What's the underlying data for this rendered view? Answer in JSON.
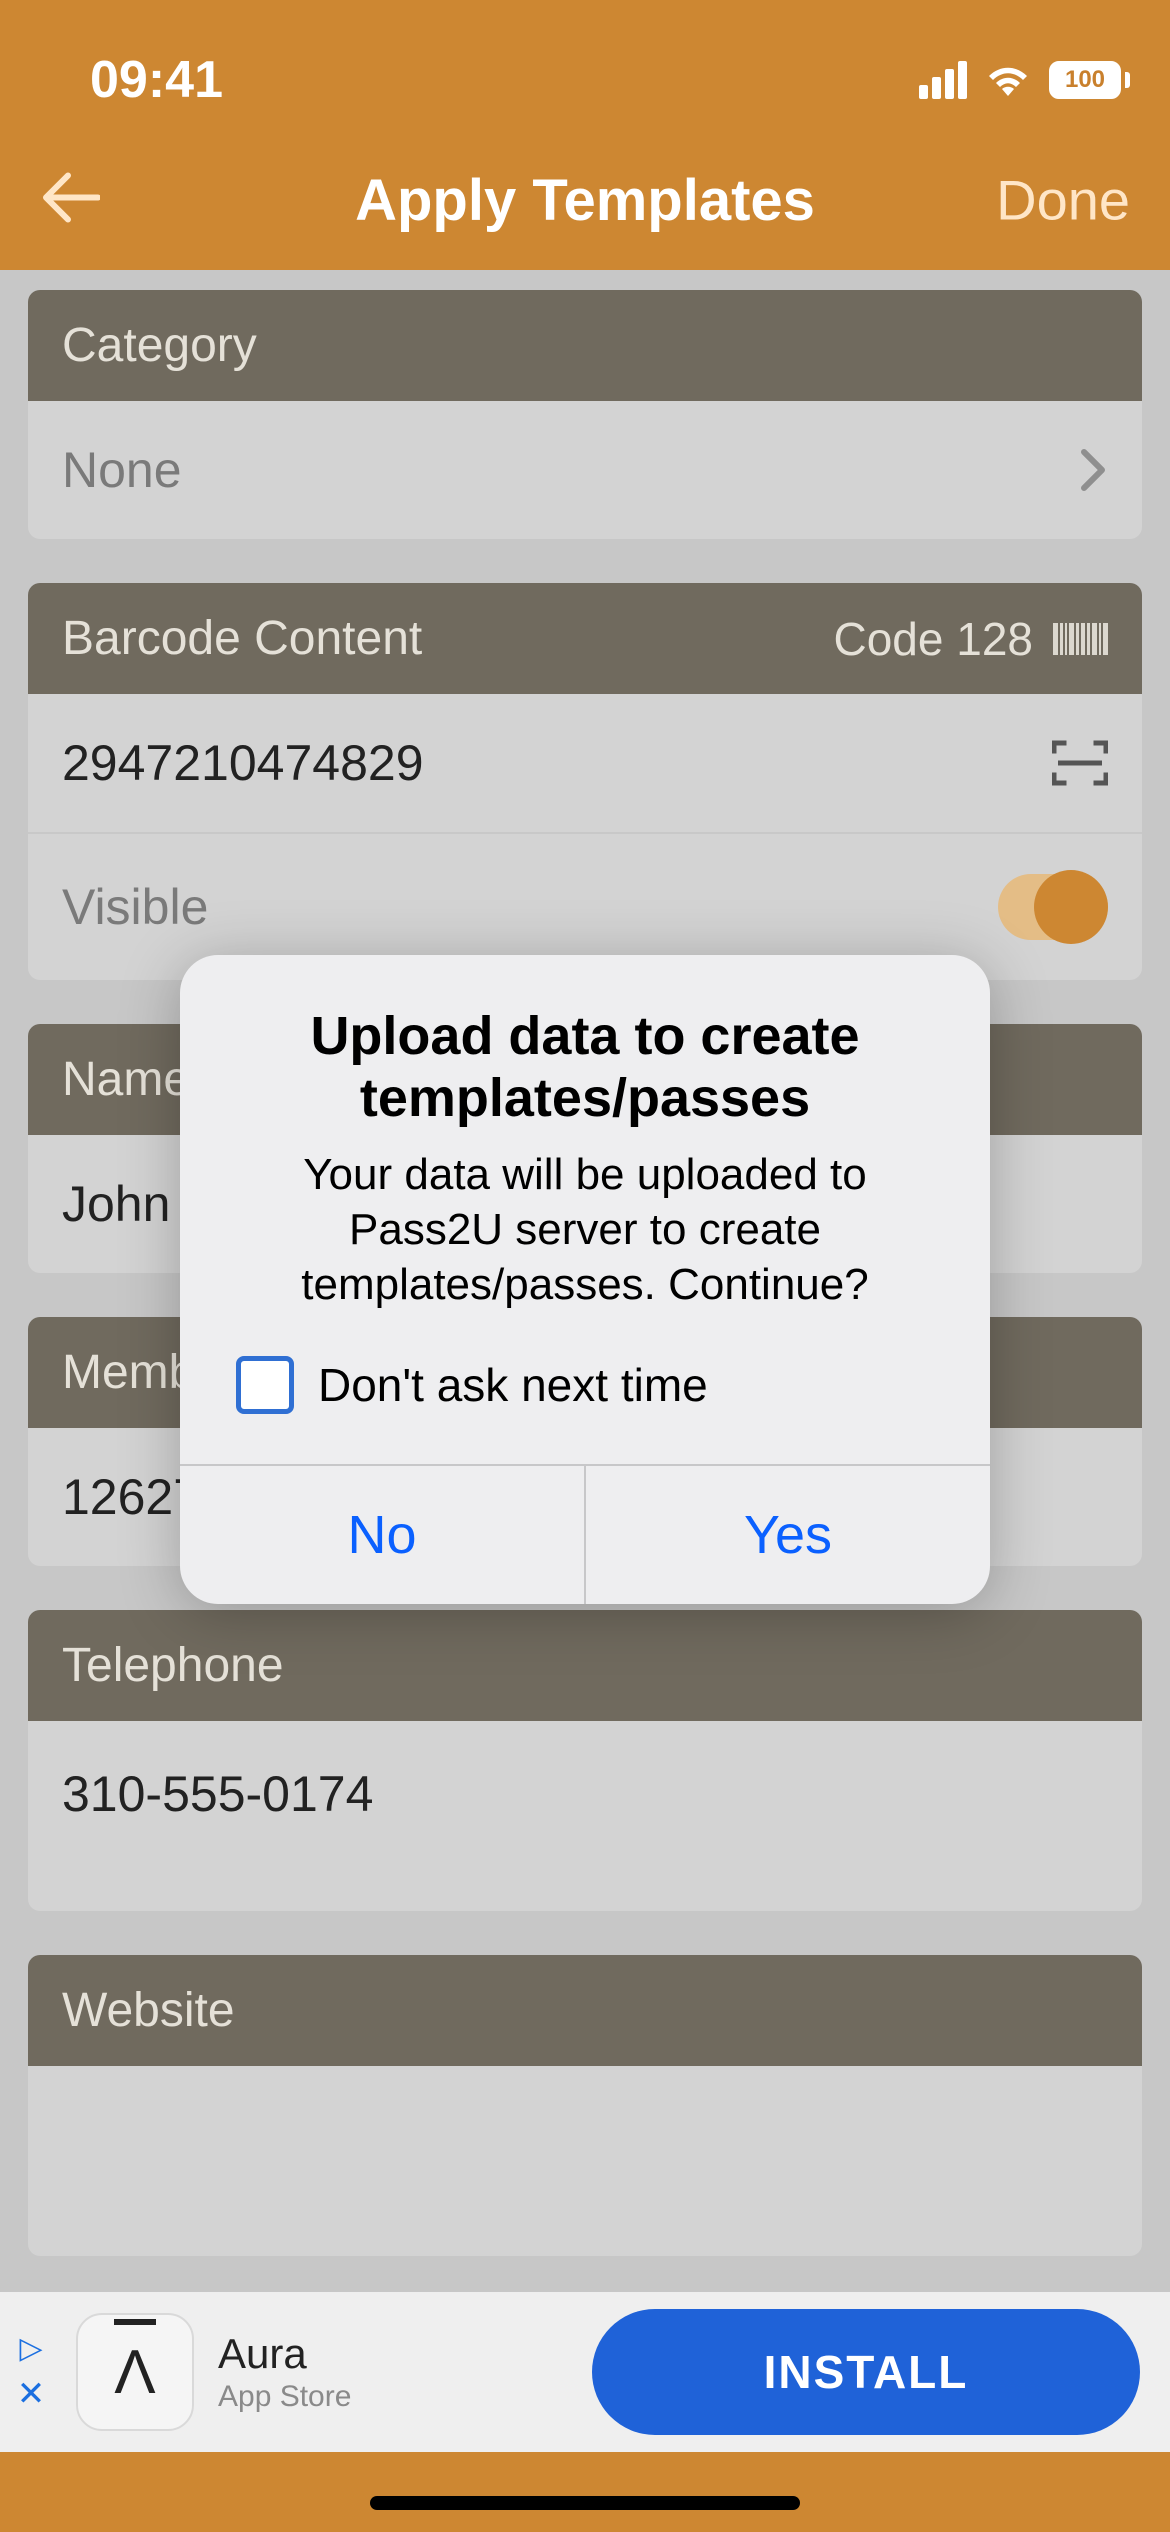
{
  "statusbar": {
    "time": "09:41",
    "battery": "100"
  },
  "nav": {
    "title": "Apply Templates",
    "done": "Done"
  },
  "category": {
    "header": "Category",
    "value": "None"
  },
  "barcode": {
    "header": "Barcode Content",
    "type": "Code 128",
    "value": "2947210474829",
    "visible_label": "Visible"
  },
  "name": {
    "header": "Name",
    "value": "John"
  },
  "member": {
    "header": "Member",
    "value": "12627"
  },
  "telephone": {
    "header": "Telephone",
    "value": "310-555-0174"
  },
  "website": {
    "header": "Website",
    "value": ""
  },
  "dialog": {
    "title": "Upload data to create templates/passes",
    "message": "Your data will be uploaded to Pass2U server to create templates/passes. Continue?",
    "checkbox_label": "Don't ask next time",
    "no": "No",
    "yes": "Yes"
  },
  "ad": {
    "title": "Aura",
    "subtitle": "App Store",
    "cta": "INSTALL"
  }
}
